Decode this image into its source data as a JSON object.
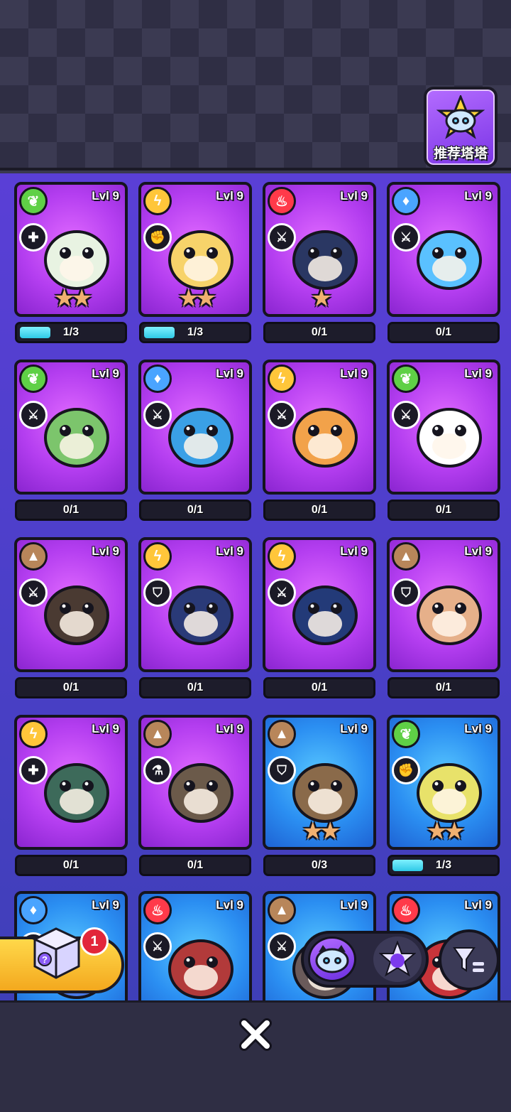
{
  "header": {
    "recommend_label": "推荐塔塔",
    "recommend_icon": "cat-bot-star-icon"
  },
  "colors": {
    "purple_card": "#b43ef0",
    "blue_card": "#2b8ff2",
    "progress_fill": "#2fc9e6",
    "badge_red": "#e2263a",
    "gift_yellow": "#ffd84a"
  },
  "cards": [
    {
      "level": "Lvl 9",
      "element": "nature",
      "role": "heal",
      "progress": "1/3",
      "fill": 0.33,
      "stars": 2,
      "bg": "purple"
    },
    {
      "level": "Lvl 9",
      "element": "lightning",
      "role": "strike",
      "progress": "1/3",
      "fill": 0.33,
      "stars": 2,
      "bg": "purple"
    },
    {
      "level": "Lvl 9",
      "element": "fire",
      "role": "attack",
      "progress": "0/1",
      "fill": 0,
      "stars": 1,
      "bg": "purple"
    },
    {
      "level": "Lvl 9",
      "element": "water",
      "role": "attack",
      "progress": "0/1",
      "fill": 0,
      "stars": 0,
      "bg": "purple"
    },
    {
      "level": "Lvl 9",
      "element": "nature",
      "role": "attack",
      "progress": "0/1",
      "fill": 0,
      "stars": 0,
      "bg": "purple"
    },
    {
      "level": "Lvl 9",
      "element": "water",
      "role": "attack",
      "progress": "0/1",
      "fill": 0,
      "stars": 0,
      "bg": "purple"
    },
    {
      "level": "Lvl 9",
      "element": "lightning",
      "role": "attack",
      "progress": "0/1",
      "fill": 0,
      "stars": 0,
      "bg": "purple"
    },
    {
      "level": "Lvl 9",
      "element": "nature",
      "role": "attack",
      "progress": "0/1",
      "fill": 0,
      "stars": 0,
      "bg": "purple"
    },
    {
      "level": "Lvl 9",
      "element": "earth",
      "role": "attack",
      "progress": "0/1",
      "fill": 0,
      "stars": 0,
      "bg": "purple"
    },
    {
      "level": "Lvl 9",
      "element": "lightning",
      "role": "shield",
      "progress": "0/1",
      "fill": 0,
      "stars": 0,
      "bg": "purple"
    },
    {
      "level": "Lvl 9",
      "element": "lightning",
      "role": "attack",
      "progress": "0/1",
      "fill": 0,
      "stars": 0,
      "bg": "purple"
    },
    {
      "level": "Lvl 9",
      "element": "earth",
      "role": "shield",
      "progress": "0/1",
      "fill": 0,
      "stars": 0,
      "bg": "purple"
    },
    {
      "level": "Lvl 9",
      "element": "lightning",
      "role": "heal",
      "progress": "0/1",
      "fill": 0,
      "stars": 0,
      "bg": "purple"
    },
    {
      "level": "Lvl 9",
      "element": "earth",
      "role": "potion",
      "progress": "0/1",
      "fill": 0,
      "stars": 0,
      "bg": "purple"
    },
    {
      "level": "Lvl 9",
      "element": "earth",
      "role": "shield",
      "progress": "0/3",
      "fill": 0,
      "stars": 2,
      "bg": "blue"
    },
    {
      "level": "Lvl 9",
      "element": "nature",
      "role": "strike",
      "progress": "1/3",
      "fill": 0.33,
      "stars": 2,
      "bg": "blue"
    },
    {
      "level": "Lvl 9",
      "element": "water",
      "role": "attack",
      "progress": "",
      "fill": 0,
      "stars": 0,
      "bg": "blue"
    },
    {
      "level": "Lvl 9",
      "element": "fire",
      "role": "attack",
      "progress": "",
      "fill": 0,
      "stars": 0,
      "bg": "blue"
    },
    {
      "level": "Lvl 9",
      "element": "earth",
      "role": "attack",
      "progress": "",
      "fill": 0,
      "stars": 0,
      "bg": "blue"
    },
    {
      "level": "Lvl 9",
      "element": "fire",
      "role": "attack",
      "progress": "",
      "fill": 0,
      "stars": 0,
      "bg": "blue"
    }
  ],
  "gift": {
    "badge_count": "1",
    "icon": "mystery-box-icon"
  },
  "toggle": {
    "active_icon": "cat-bot-icon",
    "other_icon": "cat-star-icon"
  },
  "filter": {
    "icon": "filter-icon"
  },
  "footer": {
    "close_icon": "close-icon"
  }
}
